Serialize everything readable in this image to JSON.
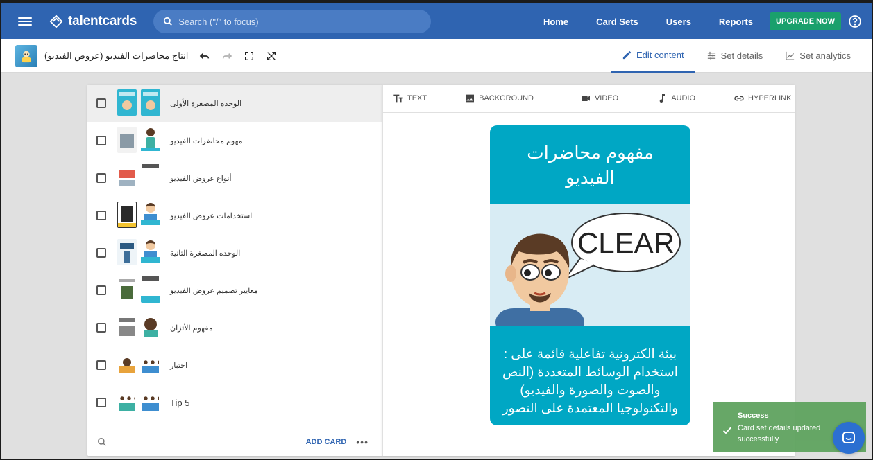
{
  "app": {
    "logo_text": "talentcards",
    "search_placeholder": "Search (\"/\" to focus)"
  },
  "nav": {
    "links": [
      "Home",
      "Card Sets",
      "Users",
      "Reports"
    ],
    "upgrade_label": "UPGRADE NOW"
  },
  "subbar": {
    "set_title": "انتاج محاضرات الفيديو (عروض الفيديو)",
    "tabs": [
      {
        "label": "Edit content",
        "icon": "pencil-icon",
        "active": true
      },
      {
        "label": "Set details",
        "icon": "sliders-icon",
        "active": false
      },
      {
        "label": "Set analytics",
        "icon": "chart-icon",
        "active": false
      }
    ]
  },
  "cards": [
    {
      "label": "الوحده المصغرة الأولى",
      "selected": true
    },
    {
      "label": "مهوم محاضرات الفيديو",
      "selected": false
    },
    {
      "label": "أنواع عروض الفيديو",
      "selected": false
    },
    {
      "label": "استخدامات عروض الفيديو",
      "selected": false
    },
    {
      "label": "الوحده المصغرة الثانية",
      "selected": false
    },
    {
      "label": "معايير تصميم عروض الفيديو",
      "selected": false
    },
    {
      "label": "مفهوم الأتزان",
      "selected": false
    },
    {
      "label": "اختبار",
      "selected": false
    },
    {
      "label": "Tip 5",
      "selected": false
    }
  ],
  "list_footer": {
    "add_card_label": "ADD CARD",
    "more_label": "•••"
  },
  "editor": {
    "tools": {
      "text": "TEXT",
      "background": "BACKGROUND",
      "video": "VIDEO",
      "audio": "AUDIO",
      "hyperlink": "HYPERLINK"
    },
    "card": {
      "title": "مفهوم محاضرات الفيديو",
      "image_text": "CLEAR",
      "body": "بيئة الكترونية تفاعلية قائمة على : استخدام الوسائط المتعددة (النص والصوت والصورة والفيديو) والتكنولوجيا المعتمدة على التصور",
      "color": "#00a7c4"
    }
  },
  "toast": {
    "title": "Success",
    "message": "Card set details updated successfully",
    "color": "#5fa35f"
  },
  "colors": {
    "brand": "#2f64b1",
    "upgrade": "#1aa06c"
  }
}
